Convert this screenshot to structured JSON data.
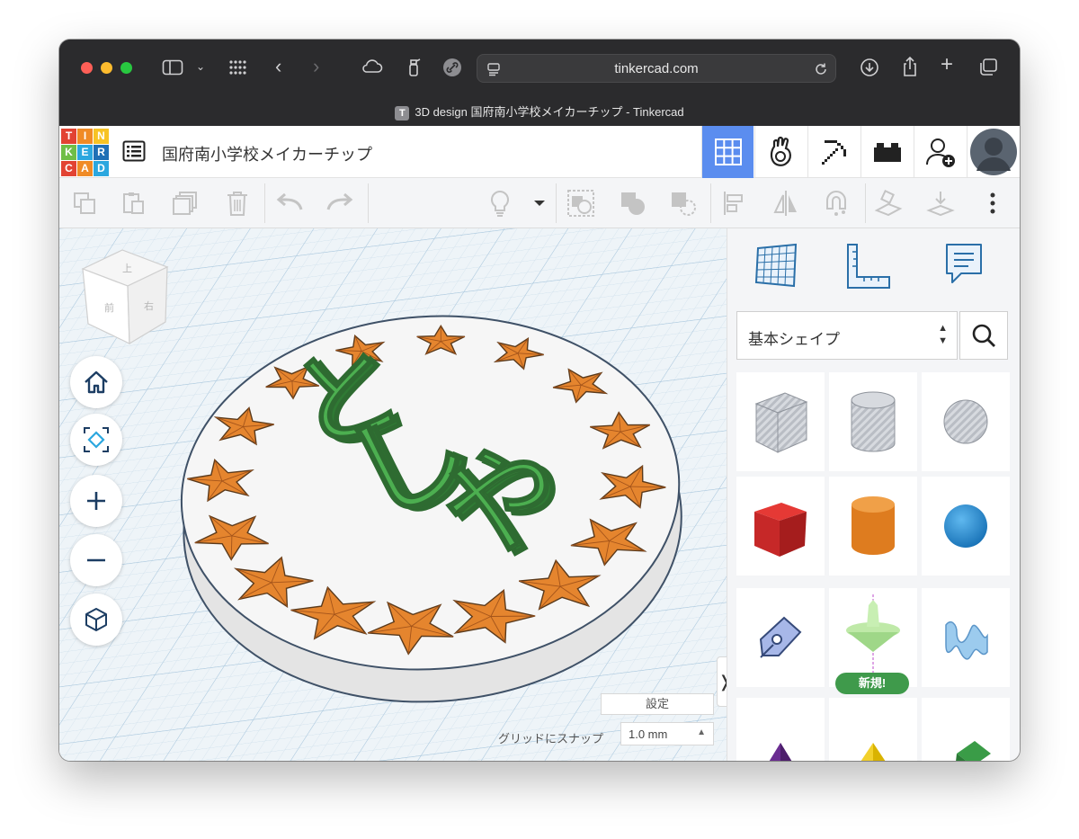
{
  "browser": {
    "url": "tinkercad.com",
    "tab_title": "3D design 国府南小学校メイカーチップ - Tinkercad",
    "favicon_letter": "T"
  },
  "logo": {
    "letters": [
      "T",
      "I",
      "N",
      "K",
      "E",
      "R",
      "C",
      "A",
      "D"
    ]
  },
  "header": {
    "design_name": "国府南小学校メイカーチップ",
    "buttons": [
      "grid-view-icon",
      "tinker-hand-icon",
      "pickaxe-icon",
      "brick-icon",
      "add-user-icon",
      "user-avatar"
    ]
  },
  "toolbar": {
    "tools": [
      "copy-icon",
      "paste-icon",
      "duplicate-icon",
      "delete-icon",
      "undo-icon",
      "redo-icon",
      "light-bulb-icon",
      "dropdown-icon",
      "group-icon",
      "solid-union-icon",
      "hole-icon",
      "align-icon",
      "mirror-icon",
      "magnet-icon",
      "cruise-icon",
      "import-icon",
      "more-options-icon"
    ]
  },
  "viewcube": {
    "top": "上",
    "front": "前",
    "right": "右"
  },
  "scene": {
    "text_letters": [
      "と",
      "し",
      "や"
    ]
  },
  "viewport": {
    "settings_label": "設定",
    "snap_label": "グリッドにスナップ",
    "snap_value": "1.0 mm"
  },
  "sidebar": {
    "shape_category": "基本シェイプ",
    "new_badge": "新規!",
    "tiles": [
      "box-striped",
      "cylinder-striped",
      "sphere-striped",
      "box",
      "cylinder",
      "sphere",
      "scribble",
      "spinner",
      "text",
      "cone",
      "pyramid",
      "roof"
    ]
  },
  "colors": {
    "tinkercad_blue": "#5b8def",
    "star_orange": "#e5852e",
    "letters_green": "#4caf50",
    "new_badge_green": "#3f9a4b"
  }
}
